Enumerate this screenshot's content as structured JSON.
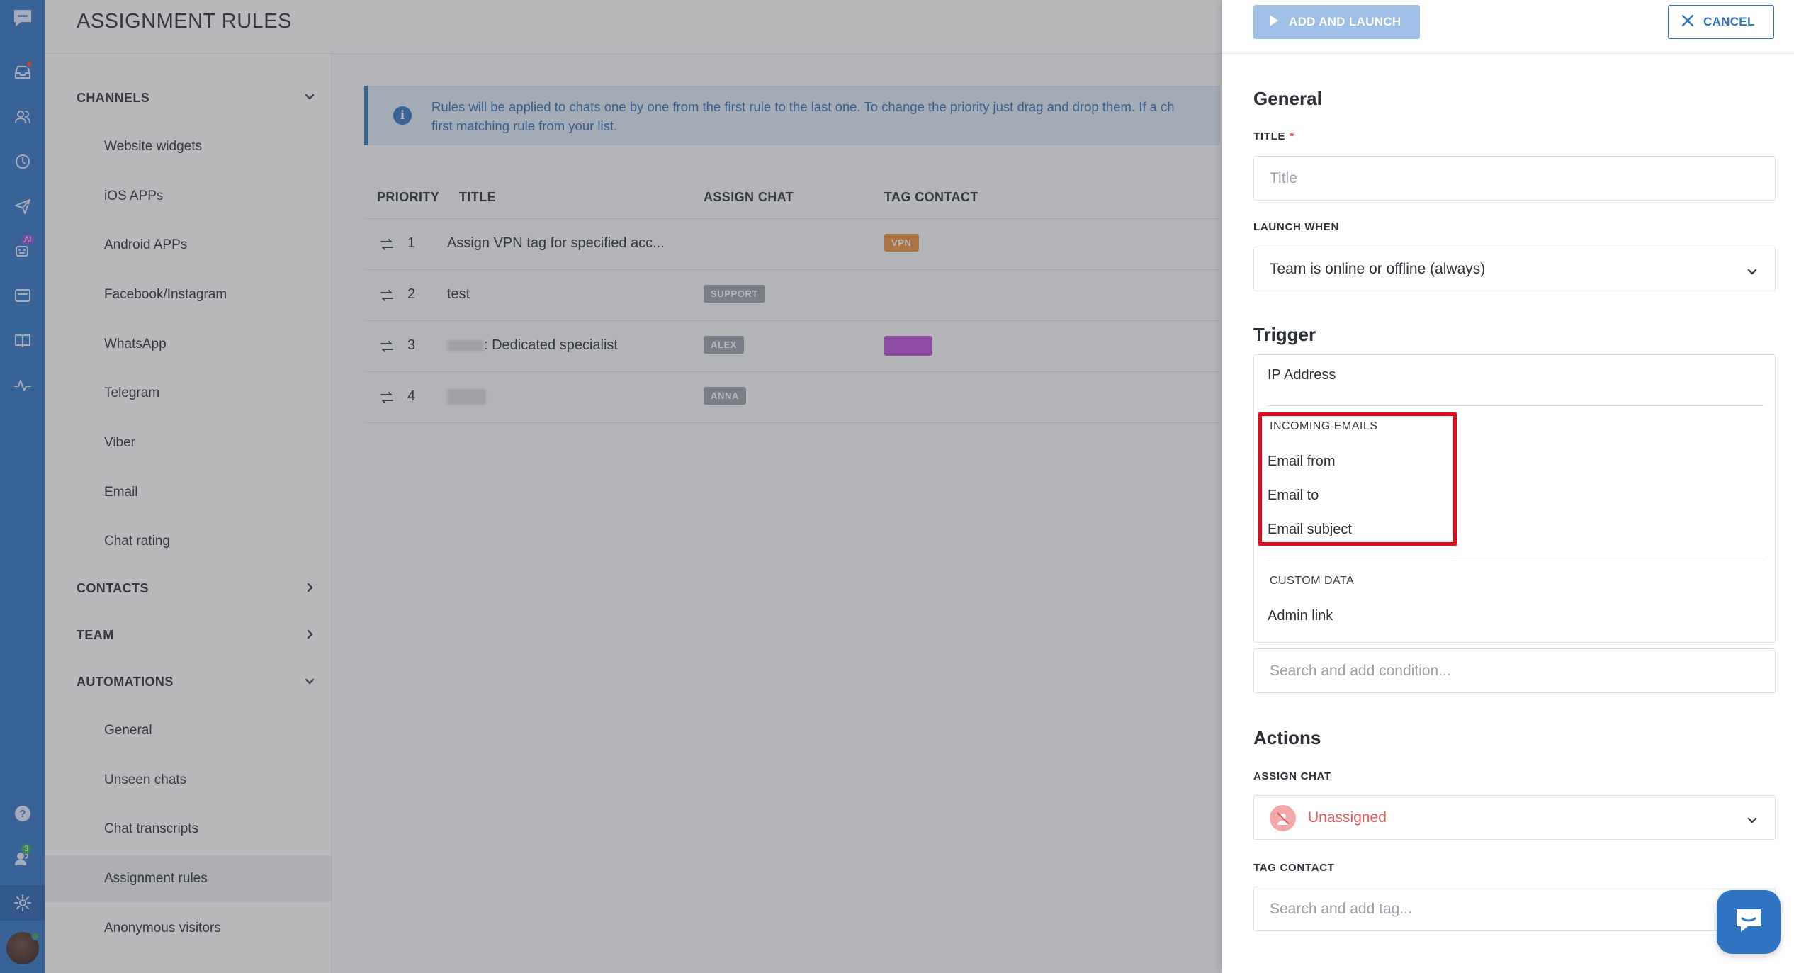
{
  "header": {
    "title": "ASSIGNMENT RULES"
  },
  "rail": {
    "items": [
      "chat-logo-icon",
      "inbox-icon",
      "contacts-icon",
      "history-icon",
      "send-icon",
      "ai-bot-icon",
      "wallet-icon",
      "book-icon",
      "activity-icon",
      "help-icon",
      "team-icon",
      "settings-icon",
      "user-avatar"
    ],
    "ai_badge": "AI",
    "team_badge": "3"
  },
  "nav": {
    "channels": {
      "label": "CHANNELS",
      "items": [
        "Website widgets",
        "iOS APPs",
        "Android APPs",
        "Facebook/Instagram",
        "WhatsApp",
        "Telegram",
        "Viber",
        "Email",
        "Chat rating"
      ]
    },
    "contacts": {
      "label": "CONTACTS"
    },
    "team": {
      "label": "TEAM"
    },
    "automations": {
      "label": "AUTOMATIONS",
      "items": [
        "General",
        "Unseen chats",
        "Chat transcripts",
        "Assignment rules",
        "Anonymous visitors"
      ],
      "selected": "Assignment rules"
    }
  },
  "info": {
    "text": "Rules will be applied to chats one by one from the first rule to the last one. To change the priority just drag and drop them. If a ch",
    "text2": "first matching rule from your list."
  },
  "table": {
    "columns": [
      "PRIORITY",
      "TITLE",
      "ASSIGN CHAT",
      "TAG CONTACT"
    ],
    "rows": [
      {
        "priority": "1",
        "title": "Assign VPN tag for specified acc...",
        "assign": "",
        "tag": "VPN"
      },
      {
        "priority": "2",
        "title": "test",
        "assign": "SUPPORT",
        "tag": ""
      },
      {
        "priority": "3",
        "title": ": Dedicated specialist",
        "assign": "ALEX",
        "tag": ""
      },
      {
        "priority": "4",
        "title": "",
        "assign": "ANNA",
        "tag": ""
      }
    ]
  },
  "colors": {
    "accent": "#2f74c3",
    "vpn_tag": "#e8923a",
    "purple_tag": "#b84fd6",
    "gray_tag": "#9aa0a8",
    "highlight": "#e5081d"
  },
  "panel": {
    "add_launch": "ADD AND LAUNCH",
    "cancel": "CANCEL",
    "general_heading": "General",
    "title_label": "TITLE",
    "title_required": "*",
    "title_placeholder": "Title",
    "launch_label": "LAUNCH WHEN",
    "launch_value": "Team is online or offline (always)",
    "trigger_heading": "Trigger",
    "trigger_options": {
      "ip": "IP Address",
      "group_incoming": "INCOMING EMAILS",
      "email_from": "Email from",
      "email_to": "Email to",
      "email_subject": "Email subject",
      "group_custom": "CUSTOM DATA",
      "admin_link": "Admin link"
    },
    "condition_placeholder": "Search and add condition...",
    "actions_heading": "Actions",
    "assign_label": "ASSIGN CHAT",
    "assign_value": "Unassigned",
    "tag_label": "TAG CONTACT",
    "tag_placeholder": "Search and add tag..."
  }
}
